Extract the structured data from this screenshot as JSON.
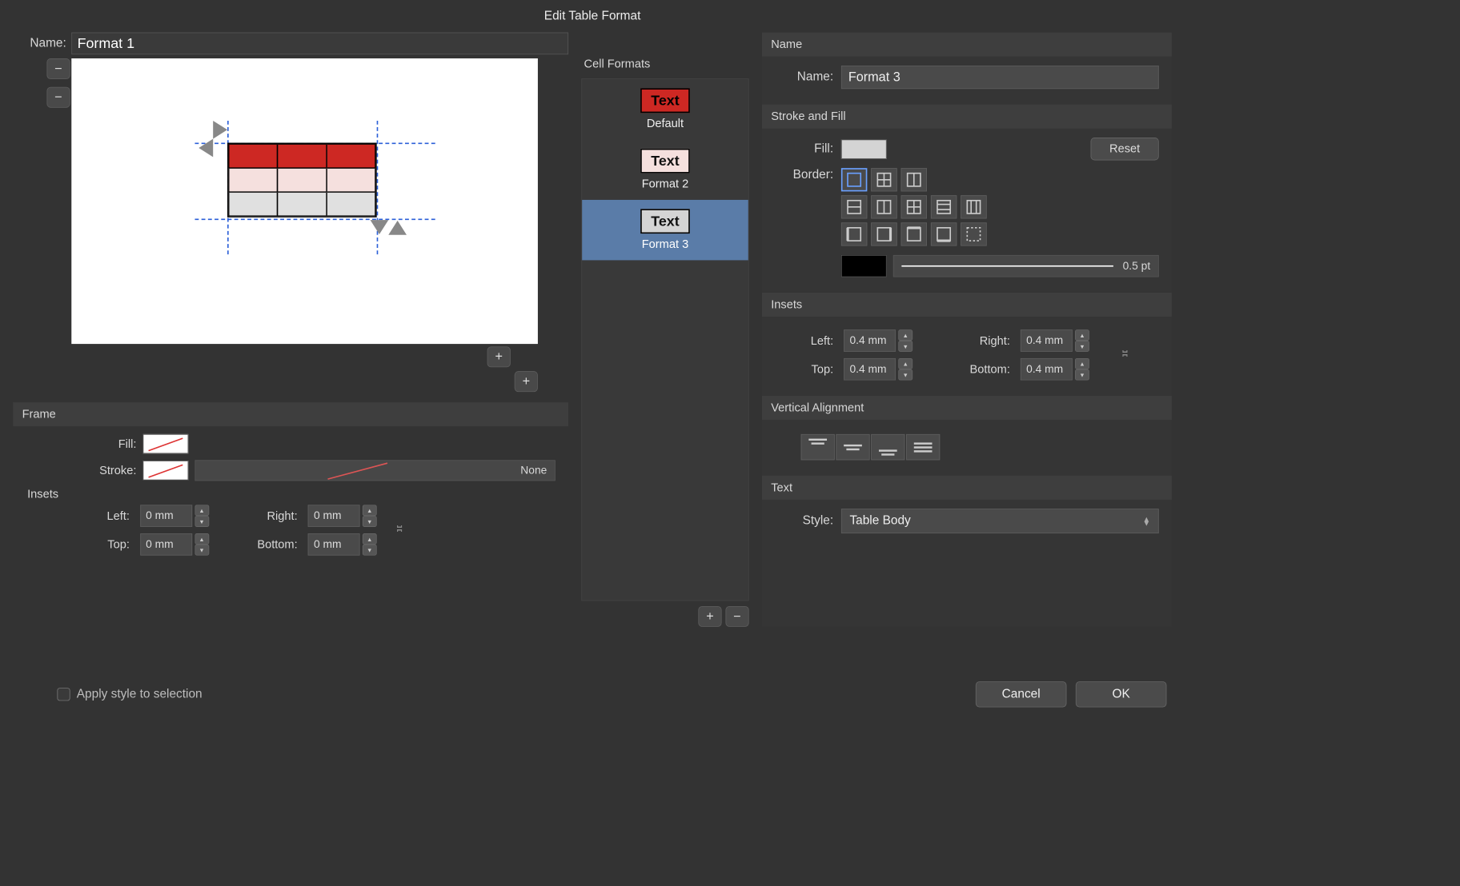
{
  "dialog": {
    "title": "Edit Table Format"
  },
  "name_field": {
    "label": "Name:",
    "value": "Format 1"
  },
  "cell_formats": {
    "title": "Cell Formats",
    "items": [
      {
        "label": "Default",
        "chip_text": "Text",
        "chip_class": "red"
      },
      {
        "label": "Format 2",
        "chip_text": "Text",
        "chip_class": "pink"
      },
      {
        "label": "Format 3",
        "chip_text": "Text",
        "chip_class": "grey"
      }
    ],
    "selected_index": 2
  },
  "frame": {
    "header": "Frame",
    "fill_label": "Fill:",
    "stroke_label": "Stroke:",
    "stroke_value": "None",
    "insets_label": "Insets",
    "left_label": "Left:",
    "right_label": "Right:",
    "top_label": "Top:",
    "bottom_label": "Bottom:",
    "left": "0 mm",
    "right": "0 mm",
    "top": "0 mm",
    "bottom": "0 mm"
  },
  "right": {
    "name_header": "Name",
    "name_label": "Name:",
    "name_value": "Format 3",
    "stroke_fill_header": "Stroke and Fill",
    "fill_label": "Fill:",
    "reset_label": "Reset",
    "border_label": "Border:",
    "border_pt": "0.5 pt",
    "insets_header": "Insets",
    "left_label": "Left:",
    "right_label": "Right:",
    "top_label": "Top:",
    "bottom_label": "Bottom:",
    "left": "0.4 mm",
    "right": "0.4 mm",
    "top": "0.4 mm",
    "bottom": "0.4 mm",
    "valign_header": "Vertical Alignment",
    "text_header": "Text",
    "style_label": "Style:",
    "style_value": "Table Body"
  },
  "footer": {
    "apply_label": "Apply style to selection",
    "cancel": "Cancel",
    "ok": "OK"
  }
}
